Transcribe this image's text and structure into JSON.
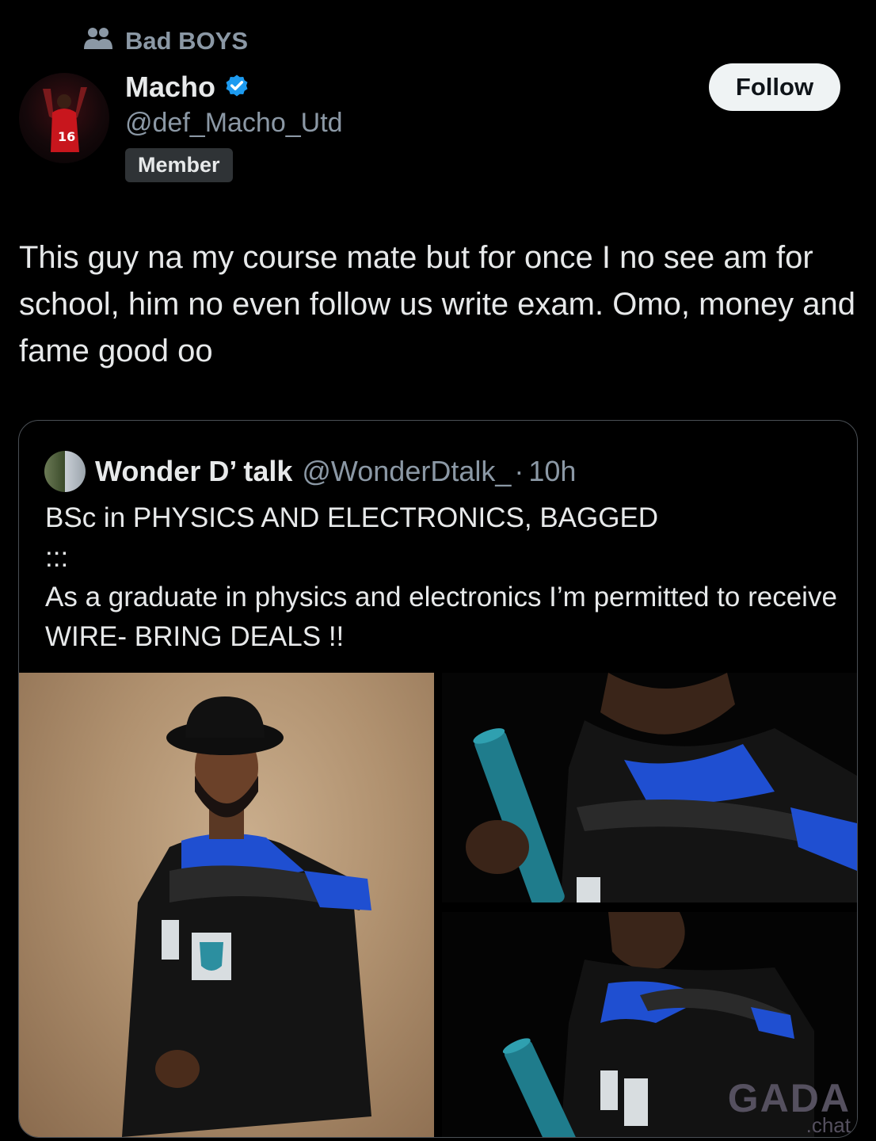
{
  "community": {
    "icon": "community-icon",
    "name": "Bad BOYS"
  },
  "author": {
    "display_name": "Macho",
    "verified_icon": "verified-badge-icon",
    "handle": "@def_Macho_Utd",
    "role_badge": "Member",
    "avatar_jersey_number": "16"
  },
  "follow_button": {
    "label": "Follow"
  },
  "tweet": {
    "text": "This guy na my course mate but for once I no see am for school, him no even follow us write exam. Omo, money and fame good oo"
  },
  "quoted_tweet": {
    "display_name": "Wonder D’ talk",
    "handle": "@WonderDtalk_",
    "separator": "·",
    "time": "10h",
    "lines": [
      "BSc in PHYSICS AND ELECTRONICS, BAGGED",
      ":::",
      "As a graduate in physics and electronics I’m permitted to receive WIRE- BRING DEALS !!"
    ],
    "media": {
      "photo_count": 3
    }
  },
  "watermark": {
    "main": "GADA",
    "sub": ".chat"
  },
  "colors": {
    "background": "#000000",
    "text_primary": "#e7e9ea",
    "text_secondary": "#8b98a5",
    "verified_blue": "#1d9bf0",
    "follow_bg": "#eff3f4",
    "gown_blue": "#1f4fd1"
  }
}
